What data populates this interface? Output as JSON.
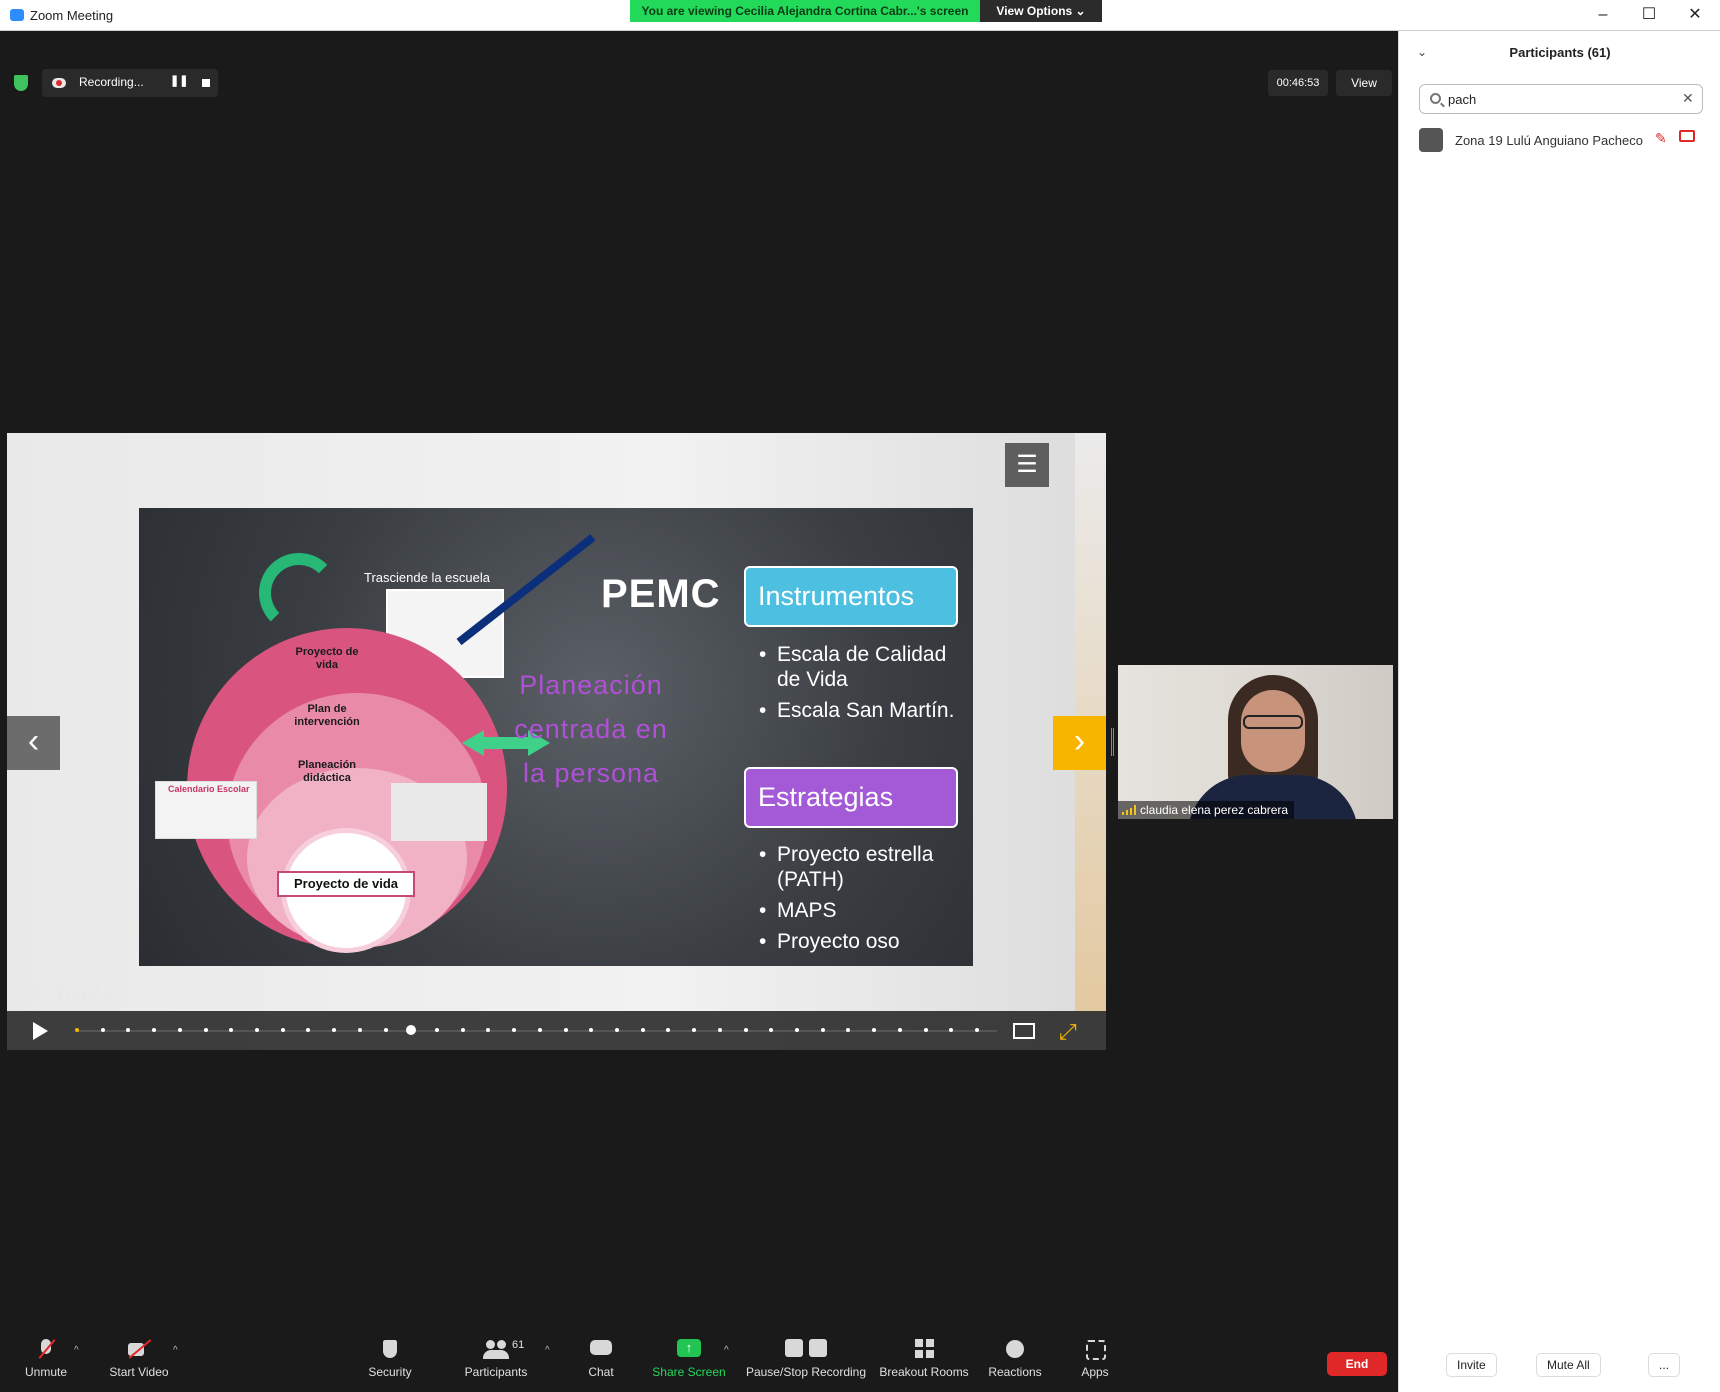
{
  "window": {
    "title": "Zoom Meeting",
    "banner": "You are viewing Cecilia Alejandra Cortina Cabr...'s screen",
    "view_options": "View Options ⌄",
    "minimize": "–",
    "maximize": "☐",
    "close": "✕"
  },
  "meeting": {
    "recording_label": "Recording...",
    "recording_pause": "❚❚",
    "timer": "00:46:53",
    "view_label": "View"
  },
  "slide": {
    "trasciende": "Trasciende la escuela",
    "pemc": "PEMC",
    "proyecto_vida_outer": "Proyecto de vida",
    "plan_intervencion": "Plan de intervención",
    "planeacion_didactica": "Planeación didáctica",
    "proyecto_vida_box": "Proyecto de vida",
    "calendario": "Calendario Escolar",
    "planeacion_centrada": "Planeación centrada en la persona",
    "instrumentos_title": "Instrumentos",
    "instrumentos_items": [
      "Escala de Calidad de Vida",
      "Escala San Martín."
    ],
    "estrategias_title": "Estrategias",
    "estrategias_items": [
      "Proyecto estrella (PATH)",
      "MAPS",
      "Proyecto oso"
    ],
    "emaze": "emaze",
    "menu_icon": "☰",
    "prev": "‹",
    "next": "›",
    "expand": "⤢",
    "progress_total": 36,
    "progress_current": 13
  },
  "video_tile": {
    "name": "claudia elena perez cabrera"
  },
  "toolbar": {
    "unmute": "Unmute",
    "start_video": "Start Video",
    "security": "Security",
    "participants": "Participants",
    "participants_count": "61",
    "chat": "Chat",
    "share_screen": "Share Screen",
    "pause_stop": "Pause/Stop Recording",
    "breakout": "Breakout Rooms",
    "reactions": "Reactions",
    "apps": "Apps",
    "end": "End",
    "caret": "^"
  },
  "participants_panel": {
    "collapse": "⌄",
    "title": "Participants (61)",
    "search_value": "pach",
    "clear": "✕",
    "rows": [
      {
        "name": "Zona 19 Lulú Anguiano Pacheco",
        "mic_icon": "mic-muted-icon",
        "video_icon": "video-off-icon"
      }
    ],
    "invite": "Invite",
    "mute_all": "Mute All",
    "more": "..."
  },
  "colors": {
    "accent_green": "#23d959",
    "end_red": "#e02828",
    "nav_yellow": "#f7b500",
    "blue_box": "#4dbfe1",
    "purple_box": "#a45ad6",
    "planeacion_text": "#b050d8"
  }
}
